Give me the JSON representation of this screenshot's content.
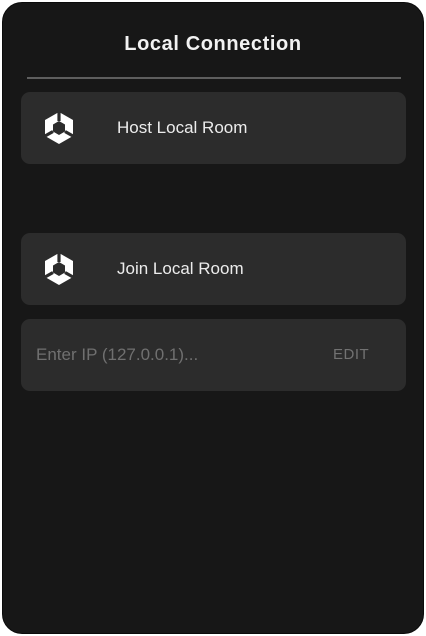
{
  "panel": {
    "title": "Local Connection"
  },
  "buttons": {
    "host": {
      "label": "Host Local Room",
      "icon": "unity-logo-icon"
    },
    "join": {
      "label": "Join Local Room",
      "icon": "unity-logo-icon"
    }
  },
  "ip_field": {
    "value": "",
    "placeholder": "Enter IP (127.0.0.1)...",
    "edit_label": "EDIT"
  },
  "colors": {
    "panel_background": "#171717",
    "button_background": "#2c2c2c",
    "divider": "#5e5e5e",
    "text_primary": "#ececec",
    "text_muted": "#707070"
  }
}
